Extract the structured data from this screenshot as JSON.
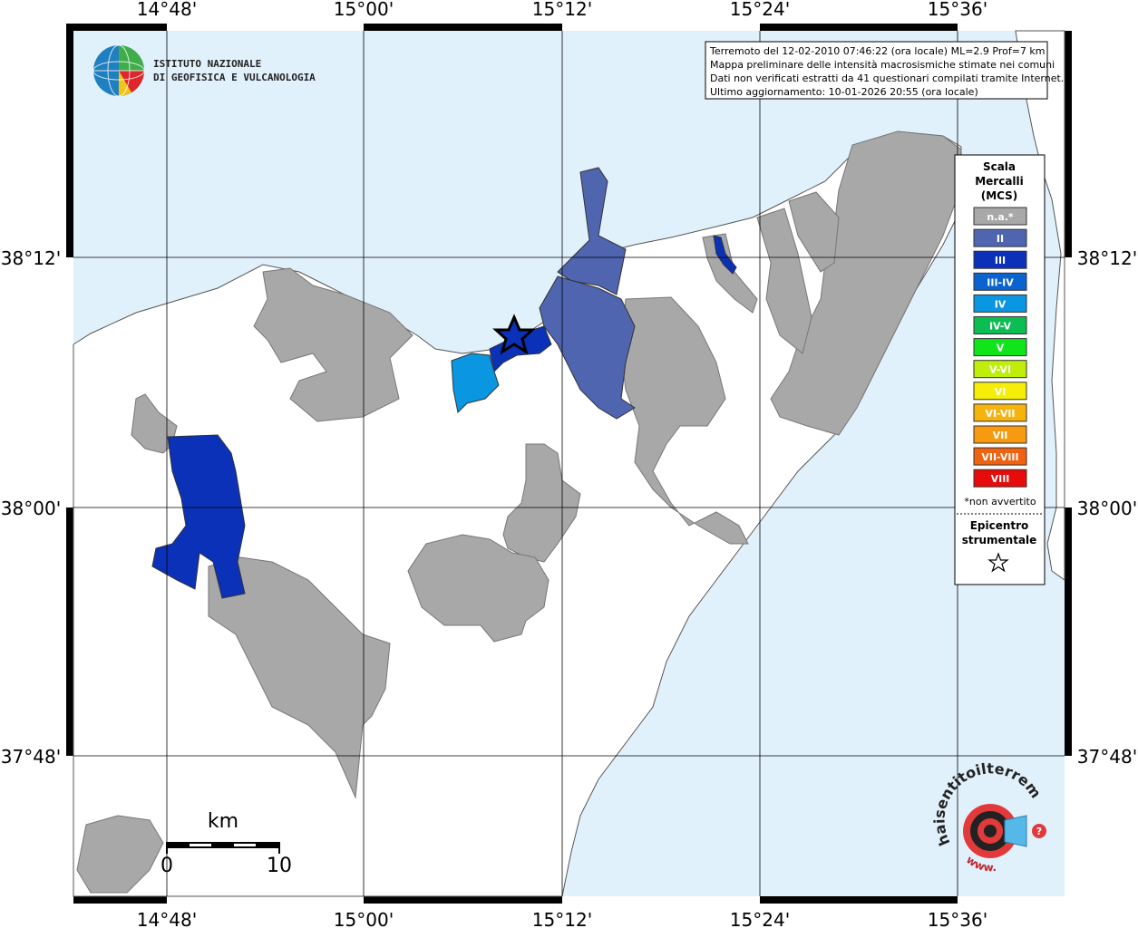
{
  "map": {
    "lon_labels": [
      "14°48'",
      "15°00'",
      "15°12'",
      "15°24'",
      "15°36'"
    ],
    "lat_labels": [
      "38°12'",
      "38°00'",
      "37°48'"
    ],
    "colors": {
      "sea": "#e1f1fc",
      "land": "#ffffff",
      "na": "#a8a8a8"
    }
  },
  "institute": {
    "line1": "ISTITUTO NAZIONALE",
    "line2": "DI GEOFISICA E VULCANOLOGIA"
  },
  "info_box": {
    "line1": "Terremoto del 12-02-2010 07:46:22 (ora locale) ML=2.9 Prof=7 km",
    "line2": "Mappa preliminare delle intensità macrosismiche stimate nei comuni",
    "line3": "Dati non verificati estratti da 41 questionari compilati tramite Internet.",
    "line4": "Ultimo aggiornamento: 10-01-2026 20:55 (ora locale)"
  },
  "legend": {
    "title1": "Scala",
    "title2": "Mercalli",
    "title3": "(MCS)",
    "classes": [
      {
        "label": "n.a.*",
        "color": "#a8a8a8"
      },
      {
        "label": "II",
        "color": "#4f65b0"
      },
      {
        "label": "III",
        "color": "#0a31b7"
      },
      {
        "label": "III-IV",
        "color": "#0b63cf"
      },
      {
        "label": "IV",
        "color": "#0b96e2"
      },
      {
        "label": "IV-V",
        "color": "#0bbd53"
      },
      {
        "label": "V",
        "color": "#0fe51a"
      },
      {
        "label": "V-VI",
        "color": "#bfee0b"
      },
      {
        "label": "VI",
        "color": "#f6ed08"
      },
      {
        "label": "VI-VII",
        "color": "#f6b30b"
      },
      {
        "label": "VII",
        "color": "#f79a0f"
      },
      {
        "label": "VII-VIII",
        "color": "#f0620f"
      },
      {
        "label": "VIII",
        "color": "#e80b0b"
      }
    ],
    "note": "*non avvertito",
    "epi1": "Epicentro",
    "epi2": "strumentale"
  },
  "scalebar": {
    "unit": "km",
    "min": "0",
    "max": "10"
  },
  "hsi_logo": {
    "text": "haisentitoilterremoto.it",
    "web": "www."
  }
}
